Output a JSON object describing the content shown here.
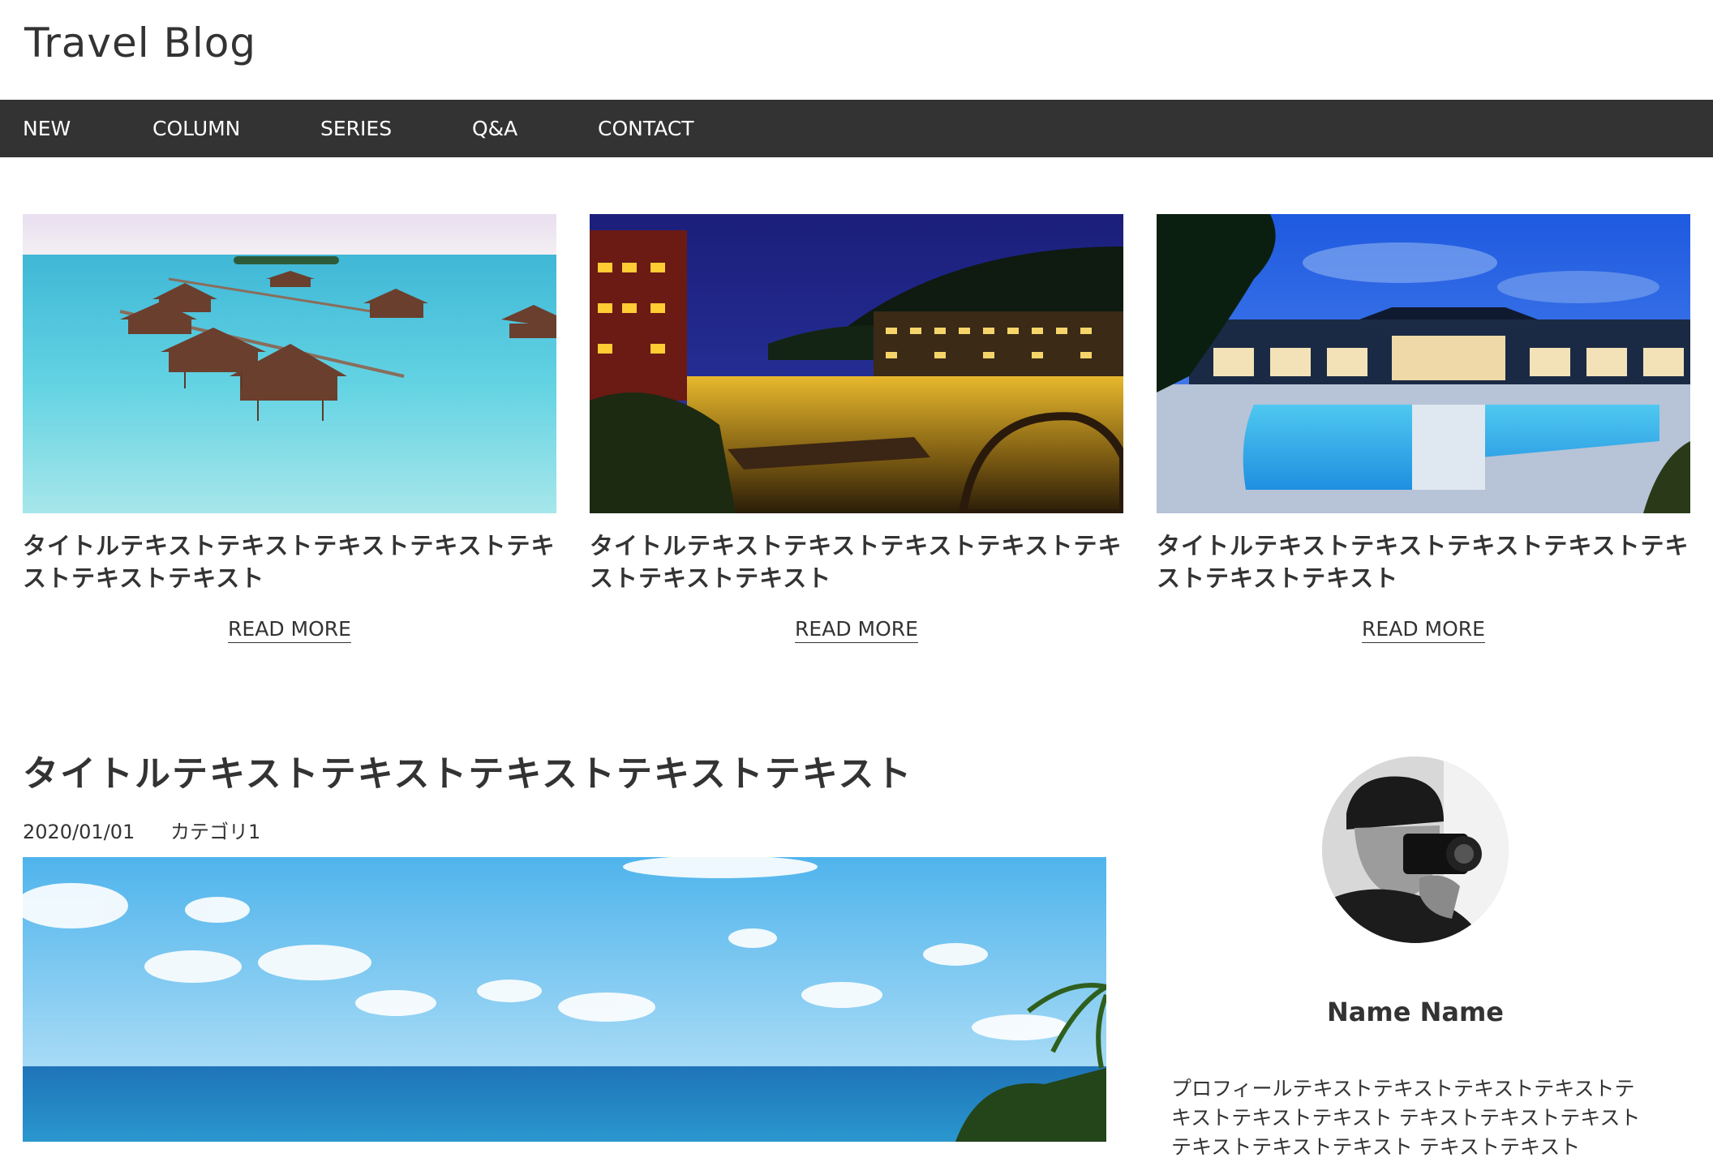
{
  "header": {
    "title": "Travel Blog"
  },
  "nav": {
    "items": [
      {
        "label": "NEW"
      },
      {
        "label": "COLUMN"
      },
      {
        "label": "SERIES"
      },
      {
        "label": "Q&A"
      },
      {
        "label": "CONTACT"
      }
    ]
  },
  "cards": [
    {
      "title": "タイトルテキストテキストテキストテキストテキストテキストテキスト",
      "read_more": "READ MORE",
      "image_icon": "overwater-bungalows-photo"
    },
    {
      "title": "タイトルテキストテキストテキストテキストテキストテキストテキスト",
      "read_more": "READ MORE",
      "image_icon": "night-river-town-photo"
    },
    {
      "title": "タイトルテキストテキストテキストテキストテキストテキストテキスト",
      "read_more": "READ MORE",
      "image_icon": "resort-pool-photo"
    }
  ],
  "post": {
    "title": "タイトルテキストテキストテキストテキストテキスト",
    "date": "2020/01/01",
    "category": "カテゴリ1",
    "image_icon": "ocean-palm-photo"
  },
  "sidebar": {
    "name": "Name Name",
    "profile_text": "プロフィールテキストテキストテキストテキストテキストテキストテキスト テキストテキストテキストテキストテキストテキスト テキストテキスト",
    "avatar_icon": "photographer-avatar"
  },
  "colors": {
    "nav_background": "#333333",
    "text": "#333333",
    "background": "#ffffff"
  }
}
